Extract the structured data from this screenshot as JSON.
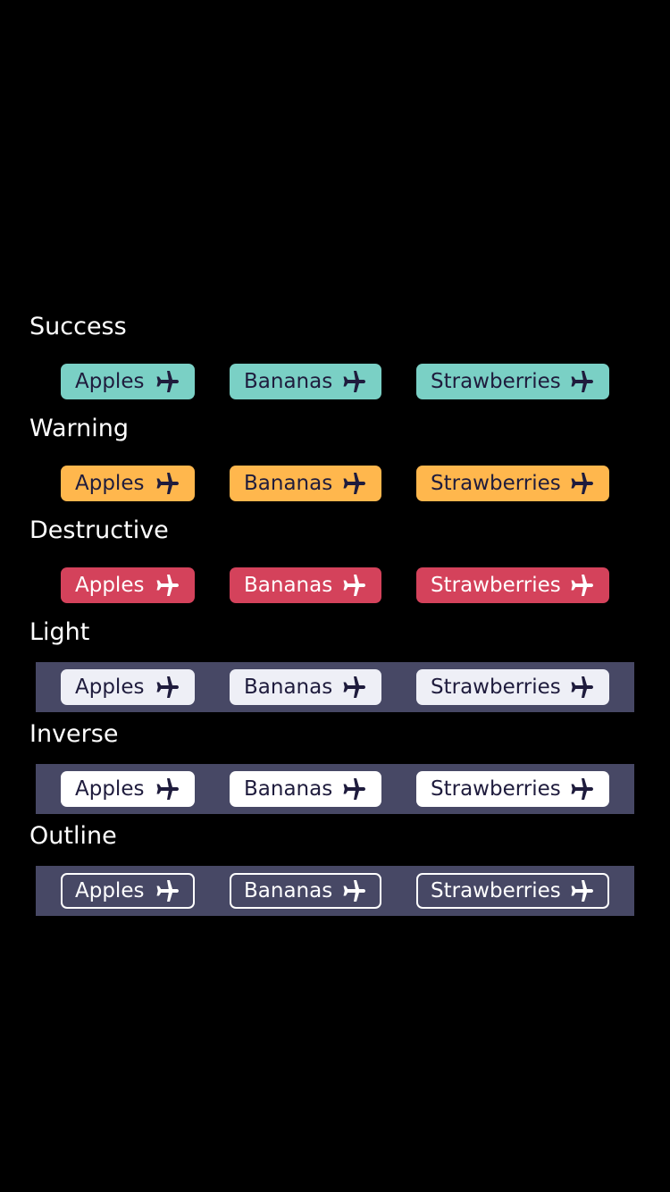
{
  "colors": {
    "background": "#000000",
    "band": "#474865",
    "success": "#7ad0c5",
    "warning": "#ffb74d",
    "destructive": "#d4425b",
    "light": "#eeeff6",
    "inverse": "#ffffff",
    "text_dark": "#1f1c3d"
  },
  "chip_icon": "airplane-icon",
  "sections": [
    {
      "title": "Success",
      "chips": [
        "Apples",
        "Bananas",
        "Strawberries"
      ]
    },
    {
      "title": "Warning",
      "chips": [
        "Apples",
        "Bananas",
        "Strawberries"
      ]
    },
    {
      "title": "Destructive",
      "chips": [
        "Apples",
        "Bananas",
        "Strawberries"
      ]
    },
    {
      "title": "Light",
      "chips": [
        "Apples",
        "Bananas",
        "Strawberries"
      ]
    },
    {
      "title": "Inverse",
      "chips": [
        "Apples",
        "Bananas",
        "Strawberries"
      ]
    },
    {
      "title": "Outline",
      "chips": [
        "Apples",
        "Bananas",
        "Strawberries"
      ]
    }
  ]
}
